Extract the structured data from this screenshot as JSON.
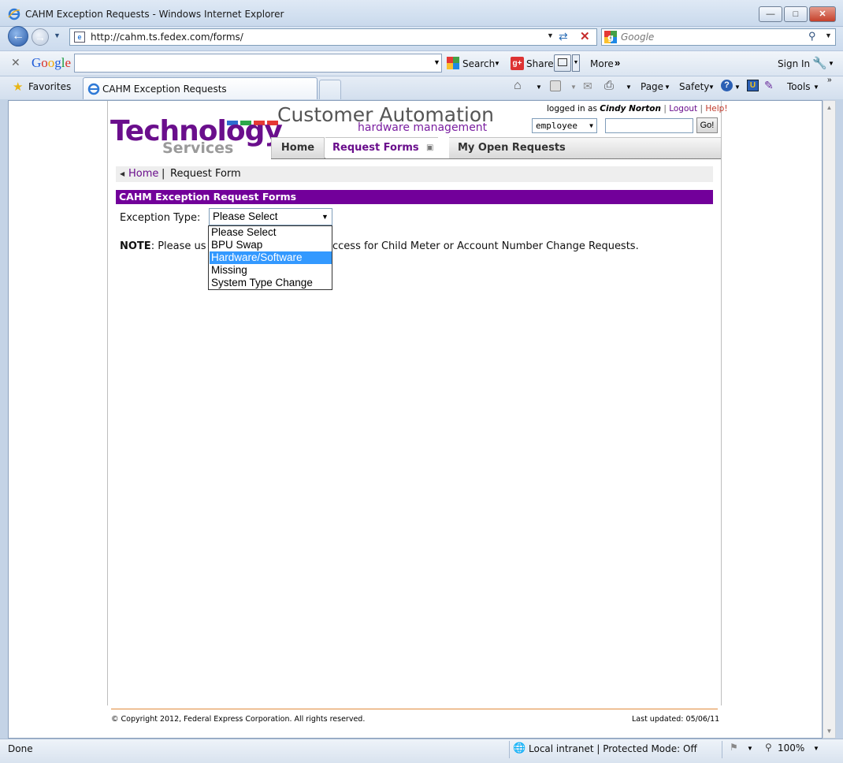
{
  "window": {
    "title": "CAHM Exception Requests - Windows Internet Explorer"
  },
  "address_bar": {
    "url": "http://cahm.ts.fedex.com/forms/",
    "search_placeholder": "Google"
  },
  "google_toolbar": {
    "logo": "Google",
    "search_label": "Search",
    "share_label": "Share",
    "more_label": "More",
    "signin_label": "Sign In"
  },
  "favorites_bar": {
    "favorites_label": "Favorites",
    "tab_label": "CAHM Exception Requests",
    "page_menu": "Page",
    "safety_menu": "Safety",
    "tools_menu": "Tools"
  },
  "site": {
    "logo_line1": "Technology",
    "logo_line2": "Services",
    "app_title": "Customer Automation",
    "app_subtitle": "hardware management",
    "logged_in_prefix": "logged in as",
    "user_name": "Cindy Norton",
    "logout": "Logout",
    "help": "Help!",
    "role_select": "employee",
    "go_button": "Go!",
    "nav": {
      "home": "Home",
      "request_forms": "Request Forms",
      "my_open_requests": "My Open Requests"
    },
    "breadcrumb": {
      "home": "Home",
      "separator": "|",
      "current": "Request Form"
    },
    "section_title": "CAHM Exception Request Forms",
    "exception_label": "Exception Type:",
    "exception_selected": "Please Select",
    "dropdown_options": [
      "Please Select",
      "BPU Swap",
      "Hardware/Software",
      "Missing",
      "System Type Change"
    ],
    "note_bold": "NOTE",
    "note_text_left": ": Please us",
    "note_text_right": "ccess for Child Meter or Account Number Change Requests.",
    "copyright": "© Copyright 2012, Federal Express Corporation. All rights reserved.",
    "last_updated": "Last updated: 05/06/11"
  },
  "status_bar": {
    "status": "Done",
    "zone": "Local intranet | Protected Mode: Off",
    "zoom": "100%"
  },
  "colors": {
    "brand_purple": "#72009a",
    "highlight": "#3399ff"
  }
}
